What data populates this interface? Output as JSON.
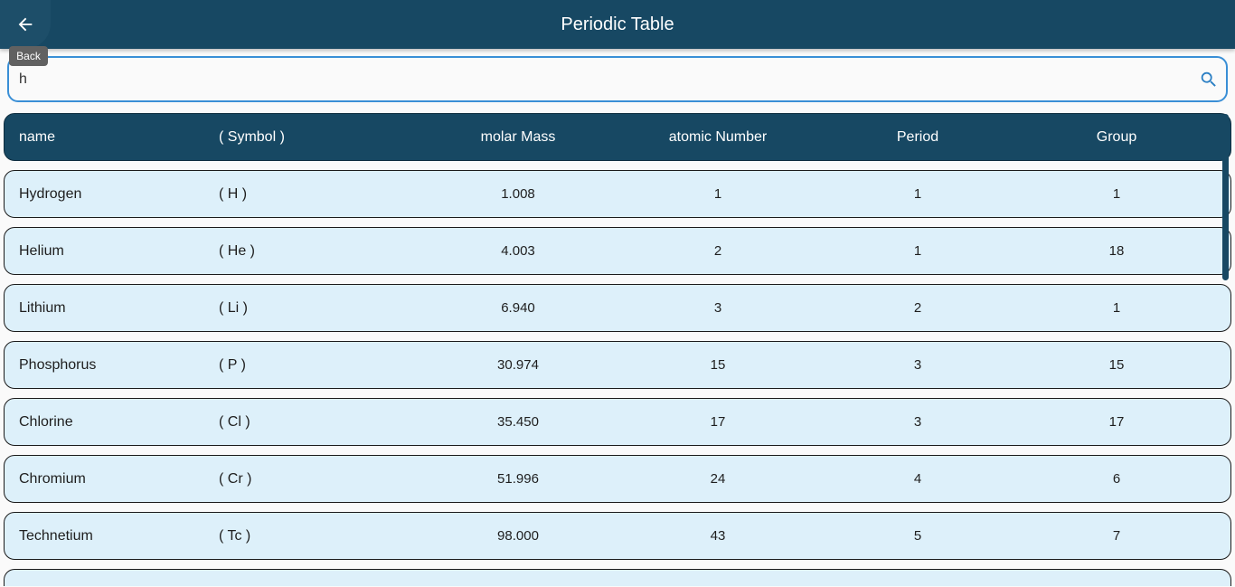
{
  "appbar": {
    "title": "Periodic Table",
    "back_tooltip": "Back"
  },
  "search": {
    "value": "h"
  },
  "table": {
    "headers": {
      "name": "name",
      "symbol": "( Symbol )",
      "molar_mass": "molar Mass",
      "atomic_number": "atomic Number",
      "period": "Period",
      "group": "Group"
    },
    "rows": [
      {
        "name": "Hydrogen",
        "symbol": "( H )",
        "molar_mass": "1.008",
        "atomic_number": "1",
        "period": "1",
        "group": "1"
      },
      {
        "name": "Helium",
        "symbol": "( He )",
        "molar_mass": "4.003",
        "atomic_number": "2",
        "period": "1",
        "group": "18"
      },
      {
        "name": "Lithium",
        "symbol": "( Li )",
        "molar_mass": "6.940",
        "atomic_number": "3",
        "period": "2",
        "group": "1"
      },
      {
        "name": "Phosphorus",
        "symbol": "( P )",
        "molar_mass": "30.974",
        "atomic_number": "15",
        "period": "3",
        "group": "15"
      },
      {
        "name": "Chlorine",
        "symbol": "( Cl )",
        "molar_mass": "35.450",
        "atomic_number": "17",
        "period": "3",
        "group": "17"
      },
      {
        "name": "Chromium",
        "symbol": "( Cr )",
        "molar_mass": "51.996",
        "atomic_number": "24",
        "period": "4",
        "group": "6"
      },
      {
        "name": "Technetium",
        "symbol": "( Tc )",
        "molar_mass": "98.000",
        "atomic_number": "43",
        "period": "5",
        "group": "7"
      }
    ]
  },
  "icons": {
    "back": "arrow-back-icon",
    "search": "search-icon"
  },
  "colors": {
    "appbar": "#174863",
    "row_background": "#ddf0fa",
    "search_border": "#3a8fd6"
  }
}
